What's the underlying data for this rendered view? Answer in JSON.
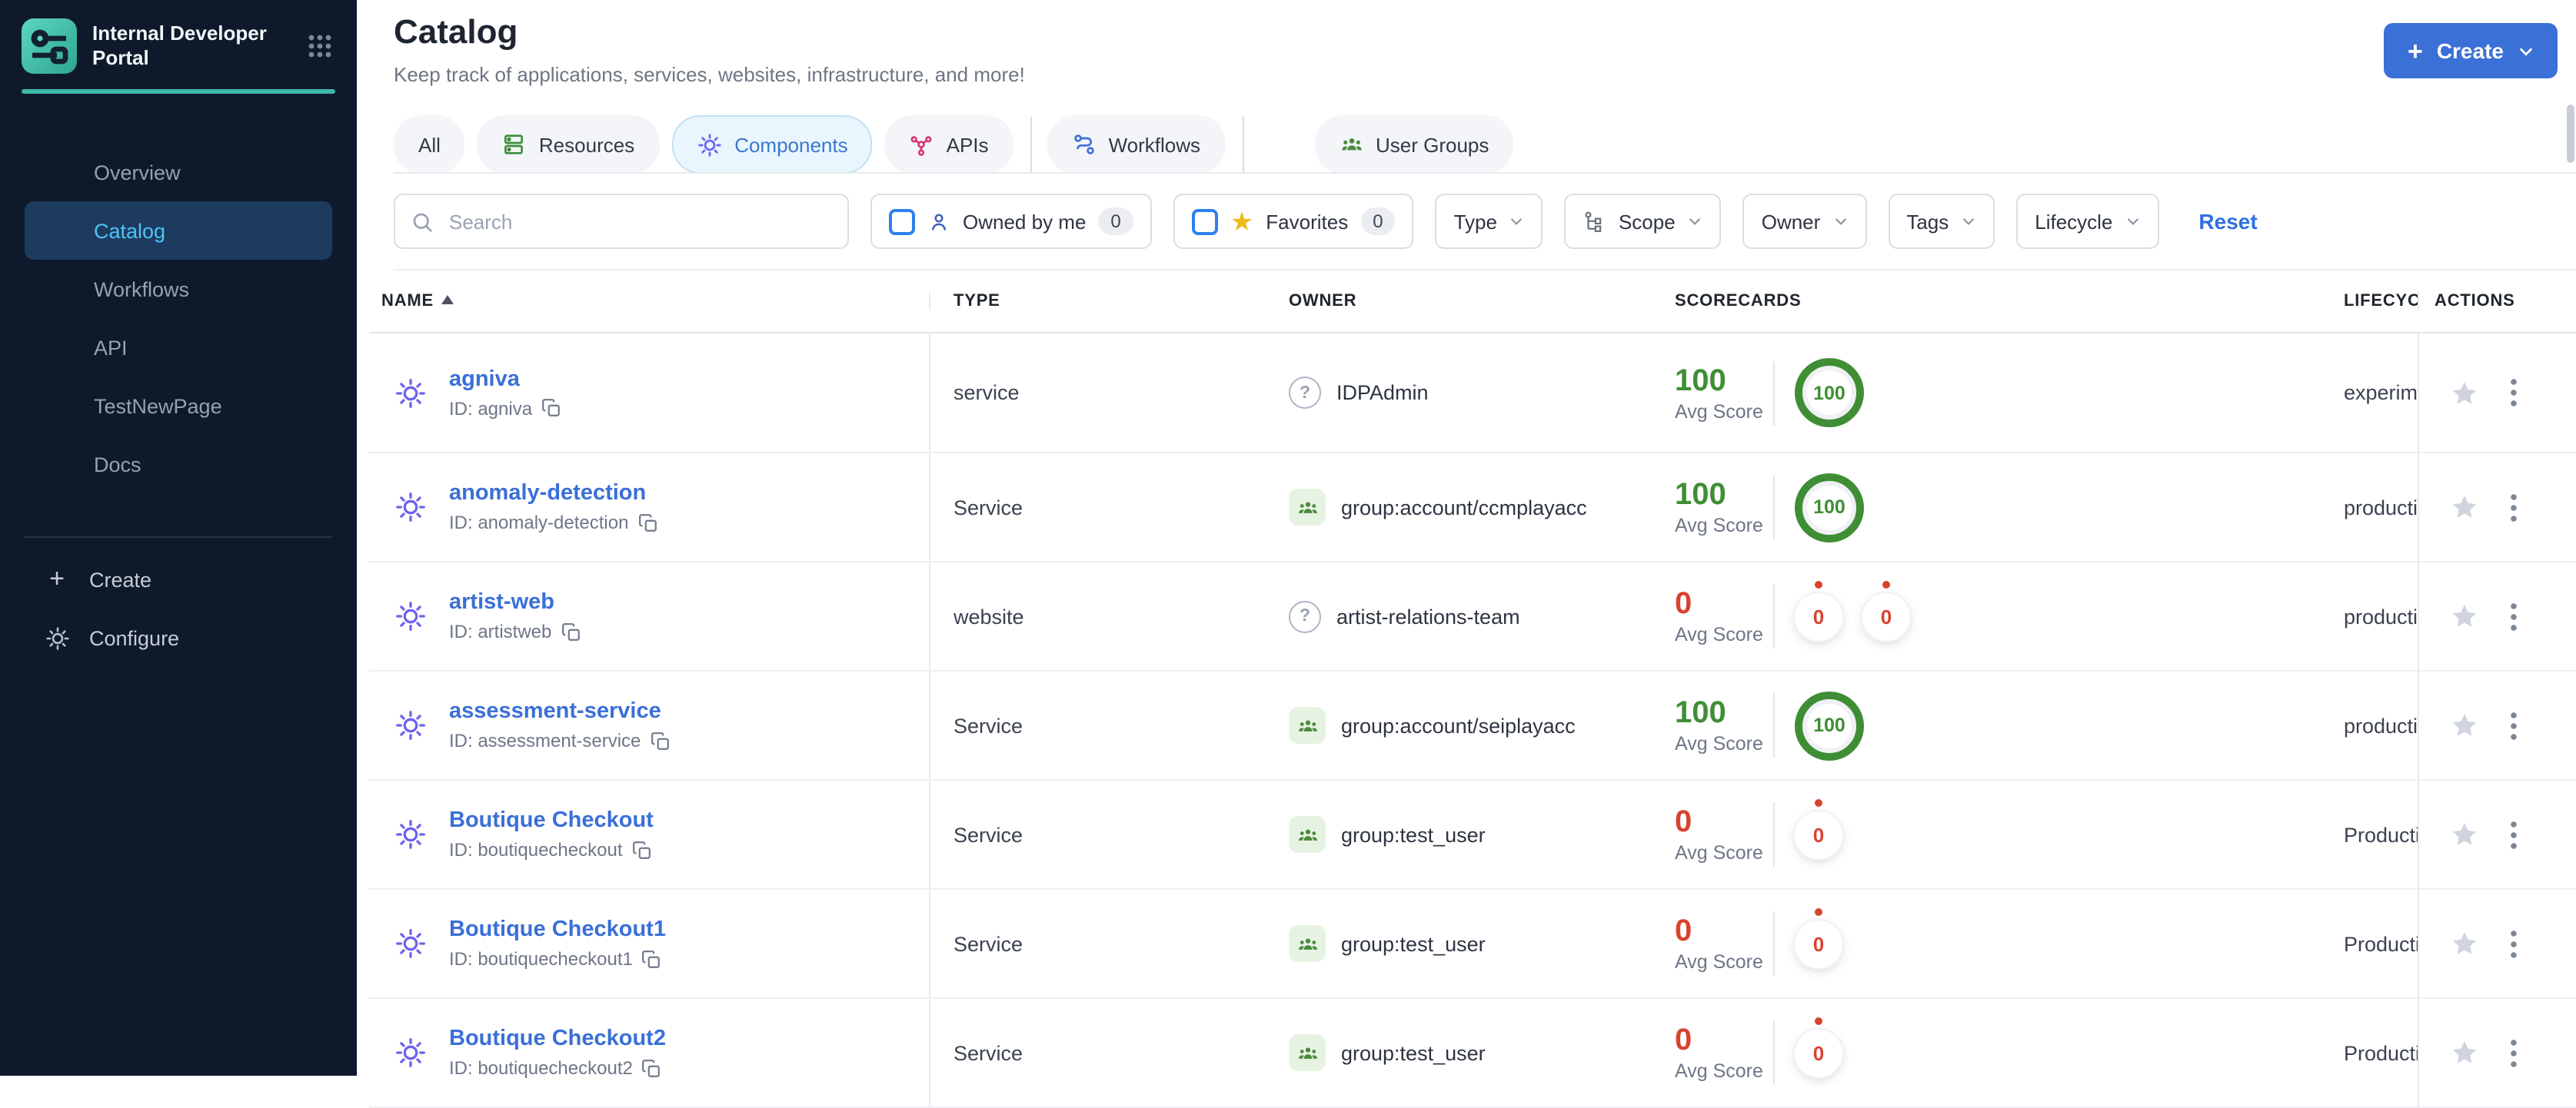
{
  "colors": {
    "sidebar_bg": "#0e1a2b",
    "sidebar_active_bg": "#1d3b5f",
    "sidebar_active_text": "#4fc3f7",
    "brand_teal": "#3eb8a6",
    "accent_blue": "#3b70d7",
    "link_blue": "#3a6fd8",
    "active_tab_bg": "#e9f6fd",
    "score_good_green": "#3f8e35",
    "score_bad_red": "#d8432f"
  },
  "brand": {
    "title": "Internal Developer Portal"
  },
  "sidebar": {
    "items": [
      {
        "label": "Overview",
        "active": false
      },
      {
        "label": "Catalog",
        "active": true
      },
      {
        "label": "Workflows",
        "active": false
      },
      {
        "label": "API",
        "active": false
      },
      {
        "label": "TestNewPage",
        "active": false
      },
      {
        "label": "Docs",
        "active": false
      }
    ],
    "create_label": "Create",
    "configure_label": "Configure"
  },
  "header": {
    "title": "Catalog",
    "subtitle": "Keep track of applications, services, websites, infrastructure, and more!",
    "create_button_label": "Create"
  },
  "tabs": [
    {
      "label": "All",
      "icon": null,
      "active": false
    },
    {
      "label": "Resources",
      "icon": "resources-icon",
      "active": false
    },
    {
      "label": "Components",
      "icon": "component-gear-icon",
      "active": true
    },
    {
      "label": "APIs",
      "icon": "apis-icon",
      "active": false
    },
    {
      "label": "Workflows",
      "icon": "workflows-icon",
      "active": false
    },
    {
      "label": "User Groups",
      "icon": "user-groups-icon",
      "active": false
    }
  ],
  "filters": {
    "search_placeholder": "Search",
    "owned_by_me": {
      "label": "Owned by me",
      "count": "0",
      "checked": false,
      "icon": "person-icon"
    },
    "favorites": {
      "label": "Favorites",
      "count": "0",
      "checked": false,
      "icon": "star-icon"
    },
    "dropdowns": [
      {
        "label": "Type",
        "icon": null
      },
      {
        "label": "Scope",
        "icon": "scope-tree-icon"
      },
      {
        "label": "Owner",
        "icon": null
      },
      {
        "label": "Tags",
        "icon": null
      },
      {
        "label": "Lifecycle",
        "icon": null
      }
    ],
    "reset_label": "Reset"
  },
  "table": {
    "columns": [
      "NAME",
      "TYPE",
      "OWNER",
      "SCORECARDS",
      "LIFECYCLE",
      "ACTIONS"
    ],
    "sort": {
      "column": "NAME",
      "direction": "asc"
    },
    "avg_score_label": "Avg Score",
    "rows": [
      {
        "name": "agniva",
        "id": "ID: agniva",
        "type": "service",
        "owner": "IDPAdmin",
        "owner_kind": "user",
        "avg_score": "100",
        "score_status": "good",
        "scorecards": [
          "100"
        ],
        "lifecycle": "experimental"
      },
      {
        "name": "anomaly-detection",
        "id": "ID: anomaly-detection",
        "type": "Service",
        "owner": "group:account/ccmplayacc",
        "owner_kind": "group",
        "avg_score": "100",
        "score_status": "good",
        "scorecards": [
          "100"
        ],
        "lifecycle": "production"
      },
      {
        "name": "artist-web",
        "id": "ID: artistweb",
        "type": "website",
        "owner": "artist-relations-team",
        "owner_kind": "user",
        "avg_score": "0",
        "score_status": "bad",
        "scorecards": [
          "0",
          "0"
        ],
        "lifecycle": "production"
      },
      {
        "name": "assessment-service",
        "id": "ID: assessment-service",
        "type": "Service",
        "owner": "group:account/seiplayacc",
        "owner_kind": "group",
        "avg_score": "100",
        "score_status": "good",
        "scorecards": [
          "100"
        ],
        "lifecycle": "production"
      },
      {
        "name": "Boutique Checkout",
        "id": "ID: boutiquecheckout",
        "type": "Service",
        "owner": "group:test_user",
        "owner_kind": "group",
        "avg_score": "0",
        "score_status": "bad",
        "scorecards": [
          "0"
        ],
        "lifecycle": "Production"
      },
      {
        "name": "Boutique Checkout1",
        "id": "ID: boutiquecheckout1",
        "type": "Service",
        "owner": "group:test_user",
        "owner_kind": "group",
        "avg_score": "0",
        "score_status": "bad",
        "scorecards": [
          "0"
        ],
        "lifecycle": "Production"
      },
      {
        "name": "Boutique Checkout2",
        "id": "ID: boutiquecheckout2",
        "type": "Service",
        "owner": "group:test_user",
        "owner_kind": "group",
        "avg_score": "0",
        "score_status": "bad",
        "scorecards": [
          "0"
        ],
        "lifecycle": "Production"
      }
    ]
  }
}
